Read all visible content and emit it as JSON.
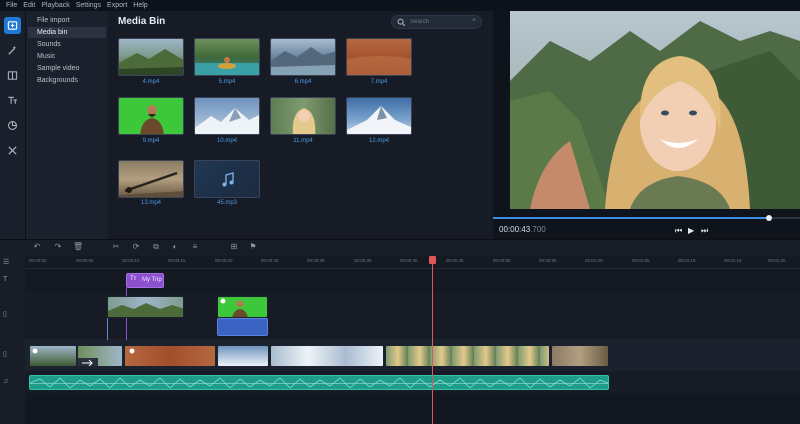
{
  "menu": [
    "File",
    "Edit",
    "Playback",
    "Settings",
    "Export",
    "Help"
  ],
  "left_tools": [
    "import-icon",
    "magic-wand-icon",
    "transitions-icon",
    "titles-icon",
    "stickers-icon",
    "tools-icon"
  ],
  "nav": {
    "items": [
      "File import",
      "Media bin",
      "Sounds",
      "Music",
      "Sample video",
      "Backgrounds"
    ],
    "selected": "Media bin"
  },
  "media_bin": {
    "title": "Media Bin",
    "search_placeholder": "Search",
    "items": [
      {
        "label": "4.mp4",
        "kind": "video"
      },
      {
        "label": "5.mp4",
        "kind": "video"
      },
      {
        "label": "6.mp4",
        "kind": "video"
      },
      {
        "label": "7.mp4",
        "kind": "video"
      },
      {
        "label": "9.mp4",
        "kind": "video"
      },
      {
        "label": "10.mp4",
        "kind": "video"
      },
      {
        "label": "11.mp4",
        "kind": "video"
      },
      {
        "label": "12.mp4",
        "kind": "video"
      },
      {
        "label": "13.mp4",
        "kind": "video"
      },
      {
        "label": "45.mp3",
        "kind": "audio"
      }
    ]
  },
  "preview": {
    "timecode": "00:00:43",
    "timecode_ms": ".700",
    "progress": 0.9
  },
  "timeline": {
    "ruler_labels": [
      "00:00:00",
      "00:00:05",
      "00:00:10",
      "00:00:15",
      "00:00:20",
      "00:00:25",
      "00:00:30",
      "00:00:35",
      "00:00:40",
      "00:00:45",
      "00:00:50",
      "00:00:55",
      "00:01:00",
      "00:01:05",
      "00:01:10",
      "00:01:15",
      "00:01:20"
    ],
    "title_clip": "My Trip"
  },
  "colors": {
    "accent": "#1f7ad6",
    "playhead": "#e05757",
    "audio": "#2bbfa6",
    "title_clip": "#8b4fd0",
    "green_screen": "#39c93a"
  }
}
